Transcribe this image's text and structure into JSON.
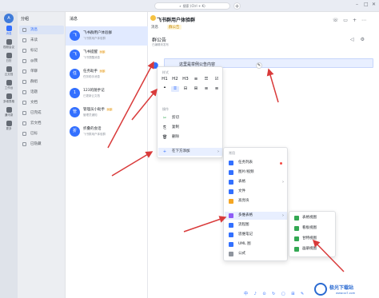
{
  "topbar": {
    "search_label": "搜索 (Ctrl + K)",
    "add_label": "+",
    "window_controls": [
      "–",
      "□",
      "✕"
    ]
  },
  "rail": {
    "avatar_initial": "A",
    "items": [
      {
        "label": "消息",
        "icon": "chat-icon",
        "active": true
      },
      {
        "label": "视频会议",
        "icon": "video-icon",
        "active": false
      },
      {
        "label": "日历",
        "icon": "calendar-icon",
        "active": false
      },
      {
        "label": "云文档",
        "icon": "doc-icon",
        "active": false
      },
      {
        "label": "工作台",
        "icon": "grid-icon",
        "active": false
      },
      {
        "label": "多维表格",
        "icon": "table-icon",
        "active": false
      },
      {
        "label": "通讯录",
        "icon": "contacts-icon",
        "active": false
      },
      {
        "label": "更多",
        "icon": "more-icon",
        "active": false
      }
    ]
  },
  "groups": {
    "header": "分组",
    "items": [
      {
        "label": "消息",
        "active": true
      },
      {
        "label": "未读",
        "active": false
      },
      {
        "label": "标记",
        "active": false
      },
      {
        "label": "@我",
        "active": false
      },
      {
        "label": "单聊",
        "active": false
      },
      {
        "label": "群组",
        "active": false
      },
      {
        "label": "话题",
        "active": false
      },
      {
        "label": "文档",
        "active": false
      },
      {
        "label": "已完成",
        "active": false
      },
      {
        "label": "云文档",
        "active": false
      },
      {
        "label": "已标",
        "active": false
      },
      {
        "label": "已隐藏",
        "active": false
      }
    ]
  },
  "chats": {
    "title": "消息",
    "items": [
      {
        "name": "飞书群用户体验群",
        "sub": "飞书群用户体验群",
        "time": "",
        "tag": "",
        "avatar": "飞"
      },
      {
        "name": "飞书提醒",
        "sub": "飞书提醒消息",
        "time": "",
        "tag": "外部",
        "avatar": "飞"
      },
      {
        "name": "任务助手",
        "sub": "任务助手消息",
        "time": "",
        "tag": "外部",
        "avatar": "任"
      },
      {
        "name": "123的随手记",
        "sub": "已更新云文档",
        "time": "",
        "tag": "",
        "avatar": "1"
      },
      {
        "name": "管理员小助手",
        "sub": "管理员通知",
        "time": "",
        "tag": "外部",
        "avatar": "管"
      },
      {
        "name": "折叠的会话",
        "sub": "飞书群用户体验群",
        "time": "",
        "tag": "",
        "avatar": "折"
      }
    ]
  },
  "main": {
    "title": "飞书群用户体验群",
    "tabs": [
      "消息",
      "群公告"
    ],
    "announcement_title": "群公告",
    "announcement_sub": "已编辑未发布",
    "text_line": "这里是举例公告内容",
    "handle_label": "⋮⋮",
    "icons": [
      "phone-icon",
      "video-icon",
      "plus-icon",
      "more-icon"
    ]
  },
  "menu1": {
    "style_label": "样式",
    "formats_row1": [
      "H1",
      "H2",
      "H3",
      "≡",
      "☰",
      "☑"
    ],
    "formats_row2": [
      "❝",
      "⌸",
      "⊟",
      "⊞",
      "≡",
      "≡"
    ],
    "ops_label": "操作",
    "items": [
      {
        "label": "剪切",
        "icon": "✂"
      },
      {
        "label": "复制",
        "icon": "⎘"
      },
      {
        "label": "删除",
        "icon": "🗑"
      },
      {
        "label": "在下方添加",
        "icon": "+"
      }
    ]
  },
  "menu2": {
    "section": "常用",
    "items": [
      {
        "label": "任务列表",
        "color": "#f54a45"
      },
      {
        "label": "图片/视频",
        "color": "#3370ff"
      },
      {
        "label": "表格",
        "color": "#3370ff"
      },
      {
        "label": "文件",
        "color": "#3370ff"
      },
      {
        "label": "高亮块",
        "color": "#f5a623"
      },
      {
        "label": "多维表格",
        "color": "#8e5cf6"
      },
      {
        "label": "流程图",
        "color": "#3370ff"
      },
      {
        "label": "思维笔记",
        "color": "#3370ff"
      },
      {
        "label": "UML 图",
        "color": "#3370ff"
      },
      {
        "label": "公式",
        "color": "#646a73"
      }
    ]
  },
  "menu3": {
    "items": [
      "表格视图",
      "看板视图",
      "甘特视图",
      "画册视图"
    ]
  },
  "bottombar": {
    "icons": "中 ♪ ⊙ ↻ ▢ ⊞ ✎"
  },
  "watermark": {
    "title": "极光下载站",
    "sub": "www.xz7.com"
  }
}
